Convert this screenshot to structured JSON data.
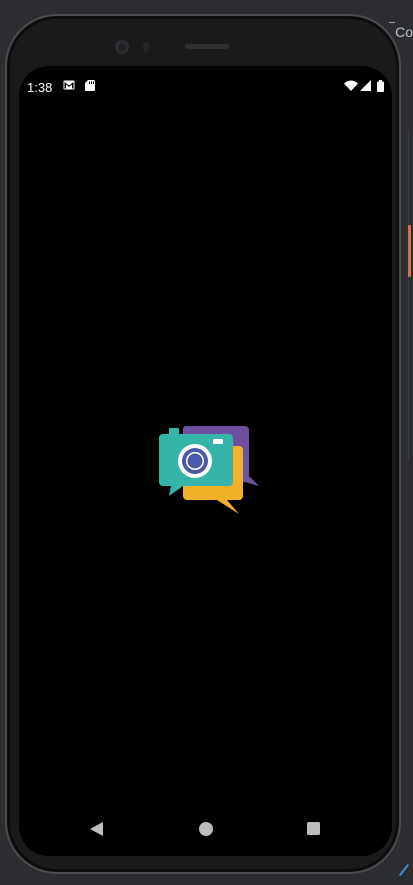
{
  "ide": {
    "top_right_text": "Co",
    "accent_color": "#d8704a"
  },
  "status_bar": {
    "time": "1:38",
    "icons": [
      "gmail-icon",
      "sd-card-icon",
      "wifi-icon",
      "signal-icon",
      "battery-icon"
    ]
  },
  "splash": {
    "logo_icon": "camera-chat-logo-icon",
    "colors": {
      "teal": "#35b4a9",
      "purple": "#6f4fa0",
      "yellow": "#f2b12b",
      "lens_ring": "#4a5aa8"
    }
  },
  "nav_bar": {
    "buttons": [
      "back-icon",
      "home-icon",
      "recents-icon"
    ]
  }
}
